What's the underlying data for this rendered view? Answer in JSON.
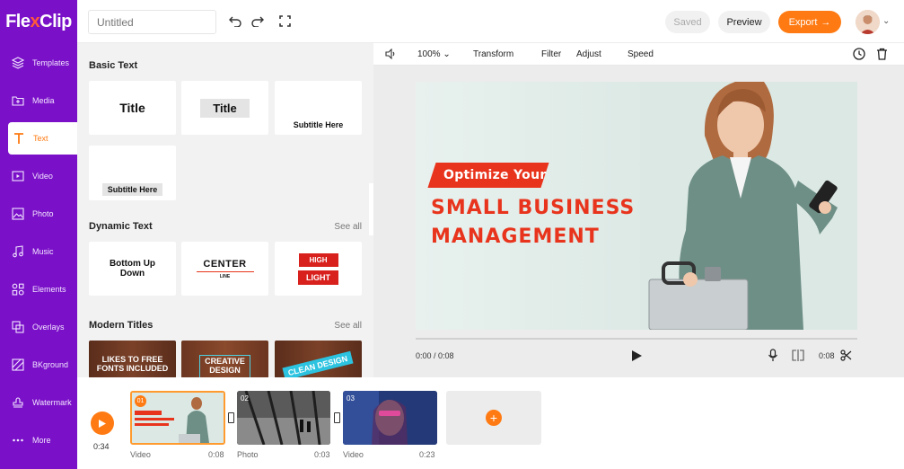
{
  "logo": {
    "text_main": "Fle",
    "text_accent": "x",
    "text_rest": "Clip"
  },
  "topbar": {
    "title_placeholder": "Untitled",
    "saved_label": "Saved",
    "preview_label": "Preview",
    "export_label": "Export"
  },
  "sidebar": {
    "items": [
      {
        "label": "Templates",
        "icon": "layers-icon"
      },
      {
        "label": "Media",
        "icon": "folder-icon"
      },
      {
        "label": "Text",
        "icon": "text-icon"
      },
      {
        "label": "Video",
        "icon": "video-icon"
      },
      {
        "label": "Photo",
        "icon": "photo-icon"
      },
      {
        "label": "Music",
        "icon": "music-icon"
      },
      {
        "label": "Elements",
        "icon": "elements-icon"
      },
      {
        "label": "Overlays",
        "icon": "overlays-icon"
      },
      {
        "label": "BKground",
        "icon": "background-icon"
      },
      {
        "label": "Watermark",
        "icon": "stamp-icon"
      },
      {
        "label": "More",
        "icon": "more-icon"
      }
    ],
    "active": "Text"
  },
  "panel": {
    "basic_text": {
      "heading": "Basic Text",
      "cards": [
        "Title",
        "Title",
        "Subtitle Here",
        "Subtitle Here"
      ]
    },
    "dynamic_text": {
      "heading": "Dynamic Text",
      "see_all": "See all",
      "cards": [
        {
          "line1": "Bottom Up",
          "line2": "Down"
        },
        {
          "line1": "CENTER",
          "line2": "LINE"
        },
        {
          "line1": "HIGH",
          "line2": "LIGHT"
        }
      ]
    },
    "modern_titles": {
      "heading": "Modern Titles",
      "see_all": "See all",
      "cards": [
        {
          "line1": "LIKES TO FREE",
          "line2": "FONTS INCLUDED"
        },
        {
          "line1": "CREATIVE",
          "line2": "DESIGN"
        },
        {
          "line1": "CLEAN DESIGN",
          "line2": ""
        }
      ]
    }
  },
  "toolbar": {
    "zoom": "100%",
    "transform": "Transform",
    "filter": "Filter",
    "adjust": "Adjust",
    "speed": "Speed"
  },
  "canvas": {
    "headline_small": "Optimize Your",
    "headline_line1": "SMALL BUSINESS",
    "headline_line2": "MANAGEMENT"
  },
  "player": {
    "current": "0:00 / 0:08",
    "duration": "0:08"
  },
  "timeline": {
    "total": "0:34",
    "clips": [
      {
        "num": "01",
        "type": "Video",
        "duration": "0:08"
      },
      {
        "num": "02",
        "type": "Photo",
        "duration": "0:03"
      },
      {
        "num": "03",
        "type": "Video",
        "duration": "0:23"
      }
    ]
  },
  "colors": {
    "brand_purple": "#7a10c8",
    "accent_orange": "#ff7a12",
    "headline_red": "#e8341c"
  }
}
